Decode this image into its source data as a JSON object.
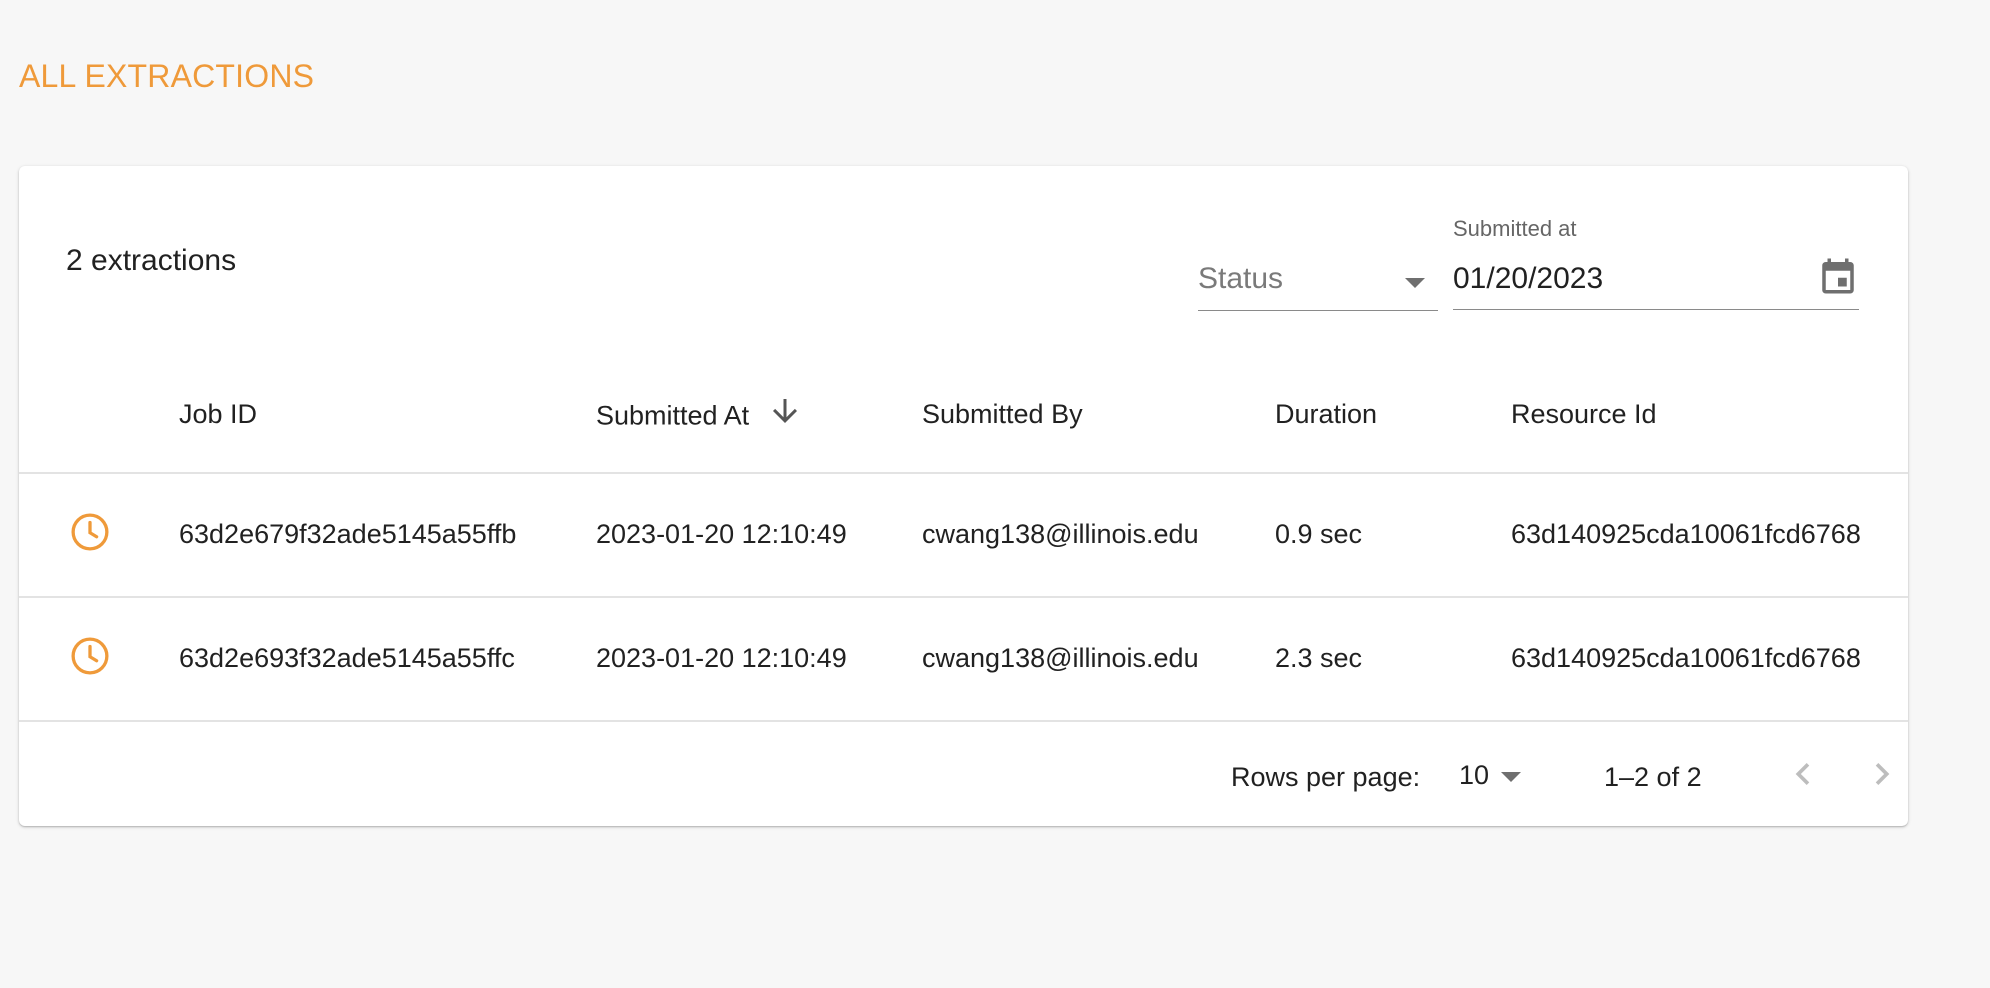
{
  "page": {
    "title": "ALL EXTRACTIONS",
    "accent_color": "#ef9a3a"
  },
  "toolbar": {
    "count_text": "2 extractions",
    "status_filter": {
      "placeholder": "Status",
      "icon": "chevron-down-icon"
    },
    "date_filter": {
      "label": "Submitted at",
      "value": "01/20/2023",
      "icon": "calendar-icon"
    }
  },
  "table": {
    "columns": [
      {
        "label": "Job ID"
      },
      {
        "label": "Submitted At",
        "sort": "descending",
        "sort_icon": "arrow-down-icon"
      },
      {
        "label": "Submitted By"
      },
      {
        "label": "Duration"
      },
      {
        "label": "Resource Id"
      }
    ],
    "rows": [
      {
        "status_icon": "clock-icon",
        "job_id": "63d2e679f32ade5145a55ffb",
        "submitted_at": "2023-01-20 12:10:49",
        "submitted_by": "cwang138@illinois.edu",
        "duration": "0.9 sec",
        "resource_id": "63d140925cda10061fcd6768"
      },
      {
        "status_icon": "clock-icon",
        "job_id": "63d2e693f32ade5145a55ffc",
        "submitted_at": "2023-01-20 12:10:49",
        "submitted_by": "cwang138@illinois.edu",
        "duration": "2.3 sec",
        "resource_id": "63d140925cda10061fcd6768"
      }
    ]
  },
  "pagination": {
    "rows_per_page_label": "Rows per page:",
    "rows_per_page_value": "10",
    "range_text": "1–2 of 2",
    "prev_icon": "chevron-left-icon",
    "next_icon": "chevron-right-icon"
  }
}
